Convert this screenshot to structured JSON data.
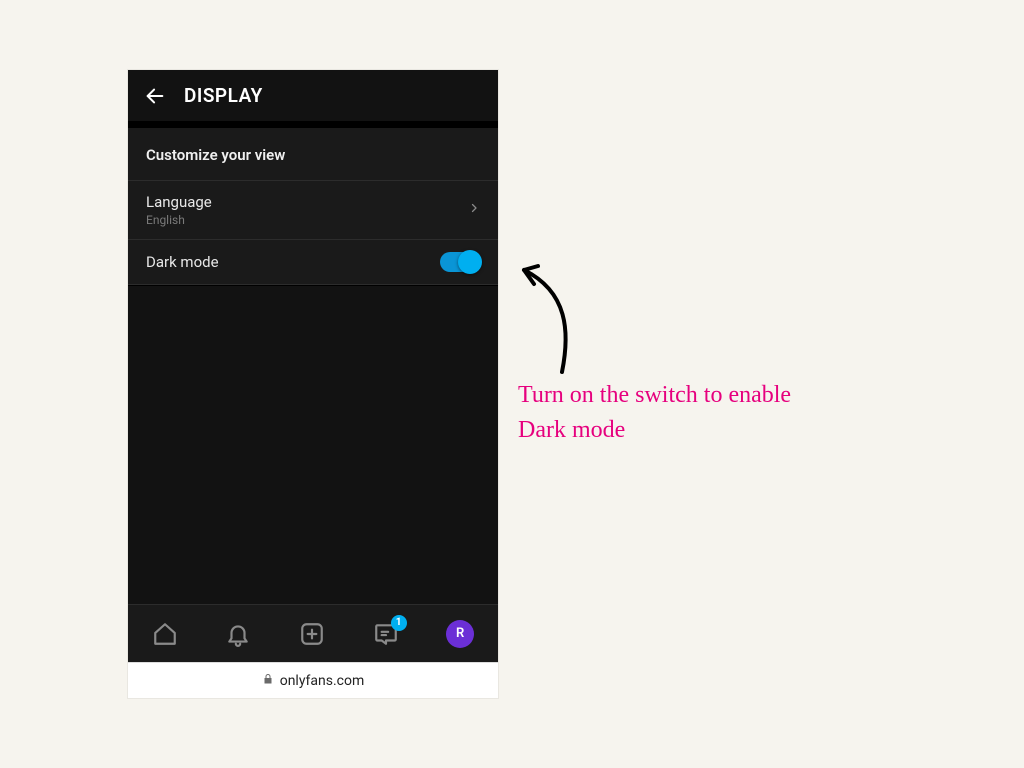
{
  "header": {
    "title": "DISPLAY"
  },
  "section": {
    "heading": "Customize your view"
  },
  "language_row": {
    "label": "Language",
    "value": "English"
  },
  "darkmode_row": {
    "label": "Dark mode",
    "enabled": true
  },
  "nav": {
    "messages_badge": "1",
    "avatar_initial": "R"
  },
  "urlbar": {
    "domain": "onlyfans.com"
  },
  "annotation": {
    "text": "Turn on the switch to enable Dark mode"
  },
  "colors": {
    "accent": "#00aff0",
    "annotation": "#e6007e",
    "avatar": "#6b2fd6"
  }
}
